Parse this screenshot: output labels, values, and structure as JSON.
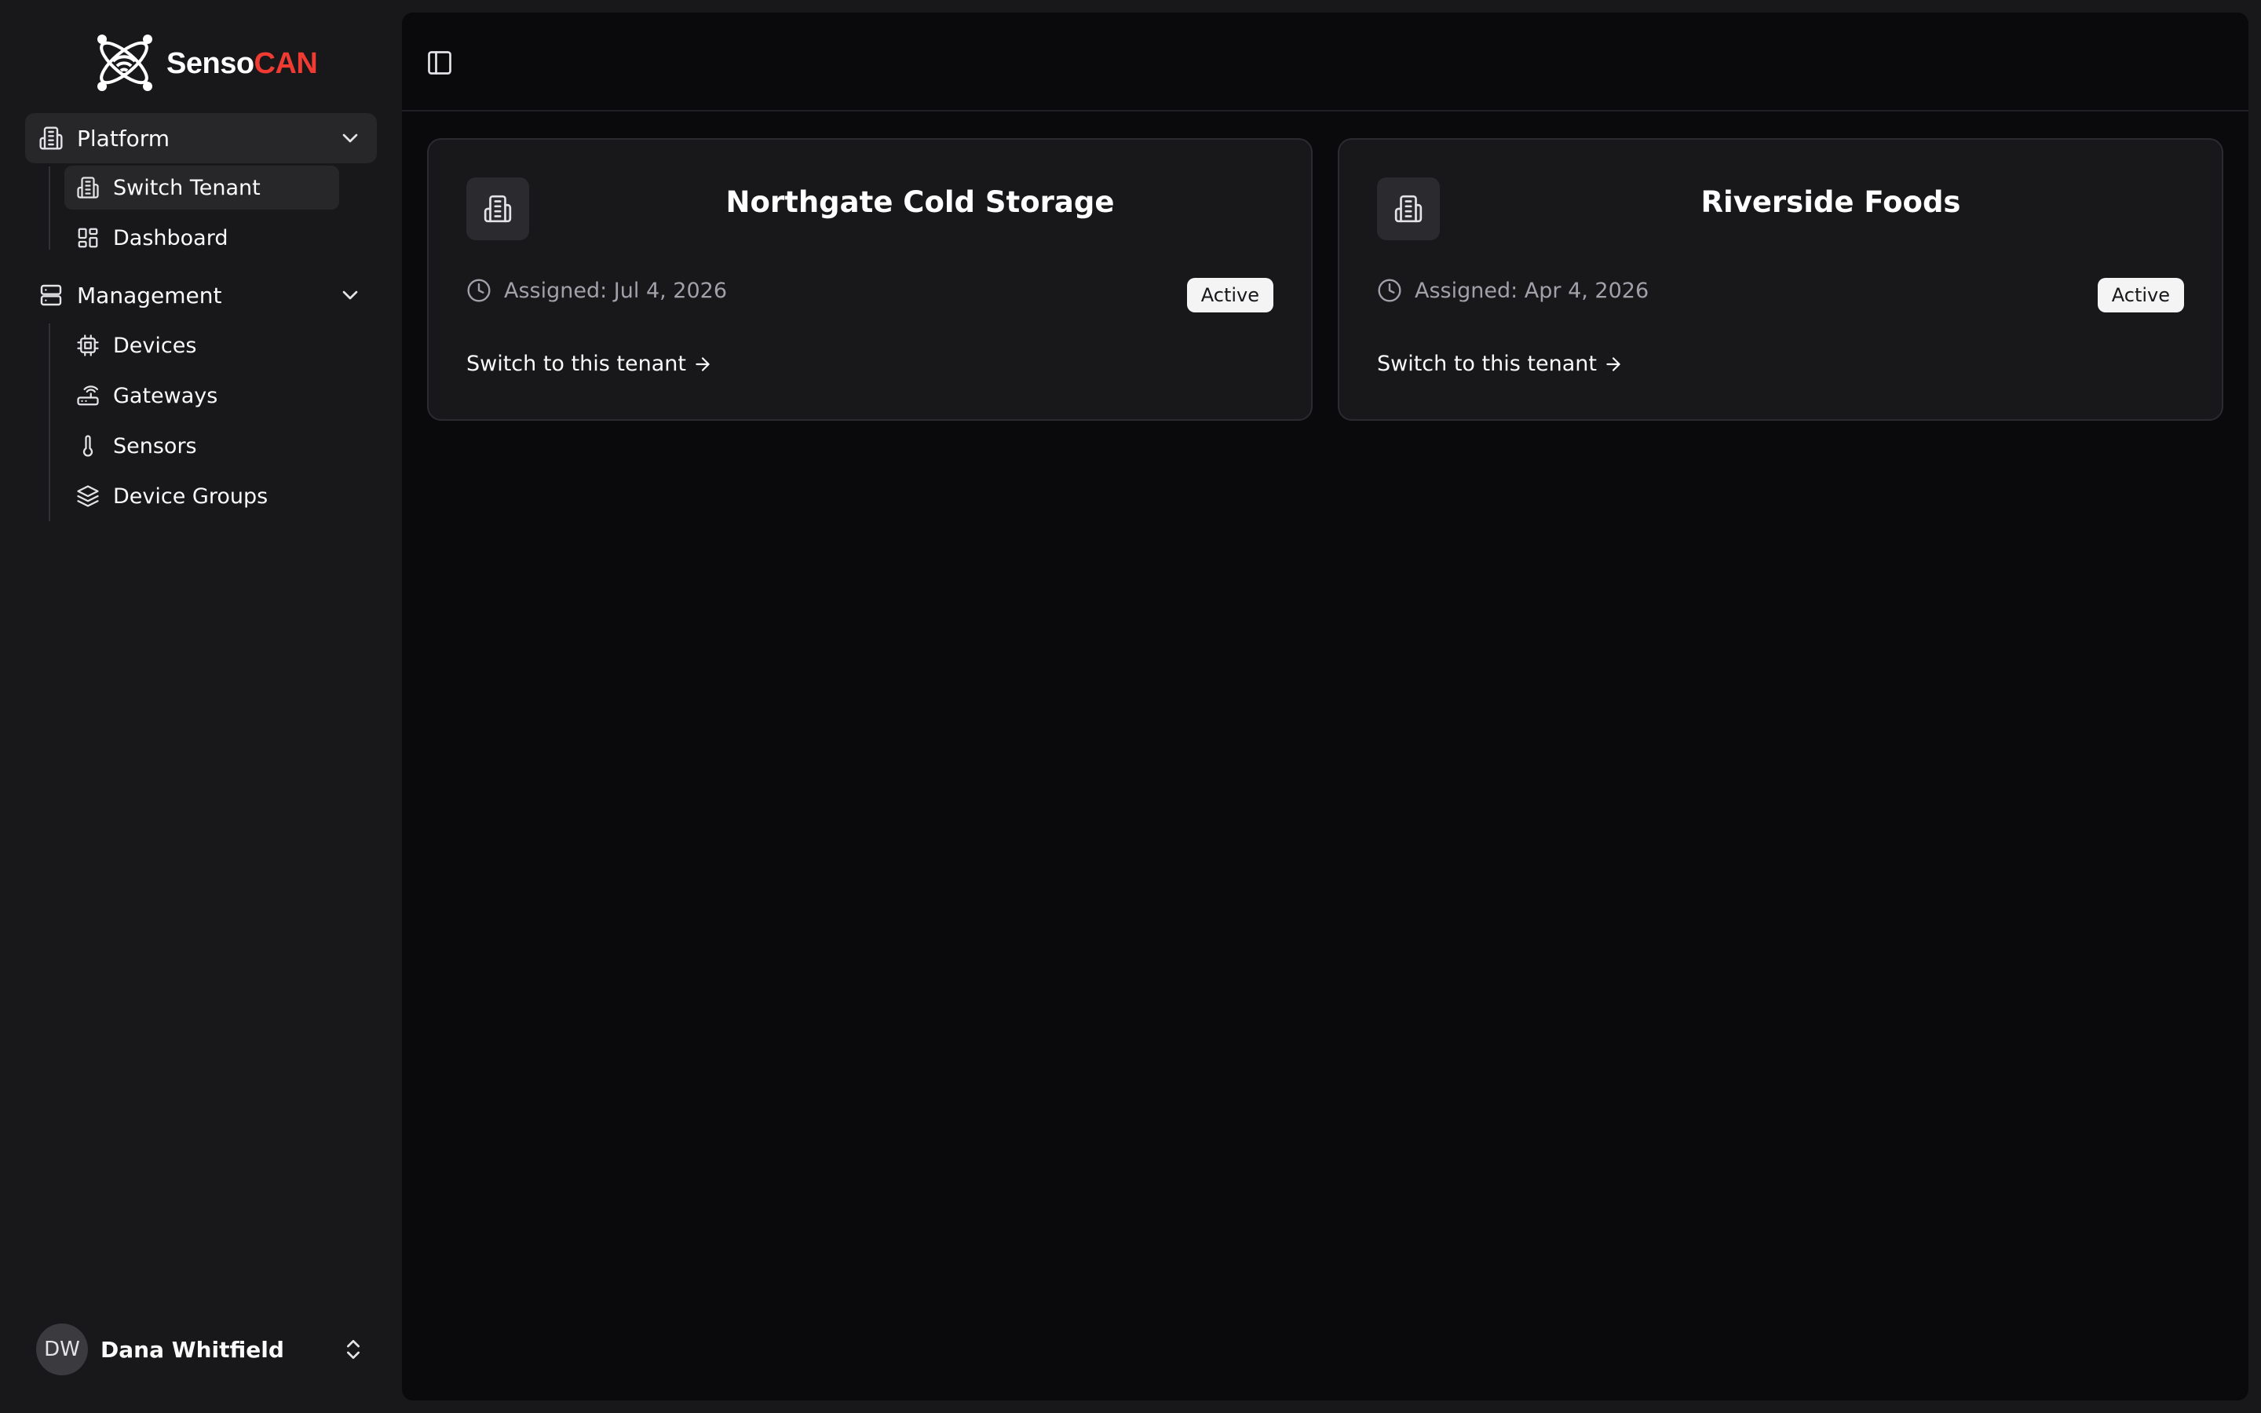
{
  "brand": {
    "name_primary": "Senso",
    "name_accent": "CAN",
    "accent_color": "#ef3b32",
    "logo_icon": "atom-wifi-logo"
  },
  "sidebar": {
    "groups": [
      {
        "label": "Platform",
        "icon": "building-icon",
        "expanded": true,
        "items": [
          {
            "label": "Switch Tenant",
            "icon": "building-icon",
            "active": true
          },
          {
            "label": "Dashboard",
            "icon": "dashboard-icon",
            "active": false
          }
        ]
      },
      {
        "label": "Management",
        "icon": "server-icon",
        "expanded": true,
        "items": [
          {
            "label": "Devices",
            "icon": "cpu-icon",
            "active": false
          },
          {
            "label": "Gateways",
            "icon": "router-icon",
            "active": false
          },
          {
            "label": "Sensors",
            "icon": "thermometer-icon",
            "active": false
          },
          {
            "label": "Device Groups",
            "icon": "layers-icon",
            "active": false
          }
        ]
      }
    ],
    "user": {
      "initials": "DW",
      "name": "Dana Whitfield"
    }
  },
  "tenants": [
    {
      "name": "Northgate Cold Storage",
      "assigned": "Assigned: Jul 4, 2026",
      "status": "Active",
      "action": "Switch to this tenant"
    },
    {
      "name": "Riverside Foods",
      "assigned": "Assigned: Apr 4, 2026",
      "status": "Active",
      "action": "Switch to this tenant"
    }
  ]
}
